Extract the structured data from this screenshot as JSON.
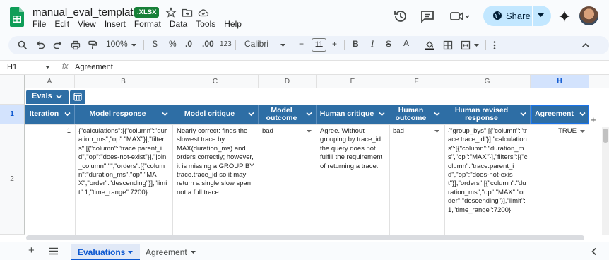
{
  "title": {
    "doc_name": "manual_eval_template",
    "badge": ".XLSX"
  },
  "menu": [
    "File",
    "Edit",
    "View",
    "Insert",
    "Format",
    "Data",
    "Tools",
    "Help"
  ],
  "share": {
    "label": "Share"
  },
  "toolbar": {
    "zoom": "100%",
    "currency": "$",
    "percent": "%",
    "dec_decrease": ".0",
    "dec_increase": ".00",
    "number_format": "123",
    "font": "Calibri",
    "font_size": "11",
    "minus": "−",
    "plus": "+"
  },
  "formula": {
    "cell_ref": "H1",
    "fx": "fx",
    "content": "Agreement"
  },
  "columns": [
    "A",
    "B",
    "C",
    "D",
    "E",
    "F",
    "G",
    "H"
  ],
  "rows": [
    "1",
    "2"
  ],
  "table": {
    "name": "Evals",
    "headers": [
      "Iteration",
      "Model response",
      "Model critique",
      "Model outcome",
      "Human critique",
      "Human outcome",
      "Human revised response",
      "Agreement"
    ]
  },
  "data_row": {
    "iteration": "1",
    "model_response": "{\"calculations\":[{\"column\":\"duration_ms\",\"op\":\"MAX\"}],\"filters\":[{\"column\":\"trace.parent_id\",\"op\":\"does-not-exist\"}],\"join_column\":\"\",\"orders\":[{\"column\":\"duration_ms\",\"op\":\"MAX\",\"order\":\"descending\"}],\"limit\":1,\"time_range\":7200}",
    "model_critique": "Nearly correct: finds the slowest trace by MAX(duration_ms) and orders correctly; however, it is missing a GROUP BY trace.trace_id so it may return a single slow span, not a full trace.",
    "model_outcome": "bad",
    "human_critique": "Agree. Without grouping by trace_id the query does not fulfill the requirement of returning a trace.",
    "human_outcome": "bad",
    "human_revised_response": "{\"group_bys\":[{\"column\":\"trace.trace_id\"}],\"calculations\":[{\"column\":\"duration_ms\",\"op\":\"MAX\"}],\"filters\":[{\"column\":\"trace.parent_id\",\"op\":\"does-not-exist\"}],\"orders\":[{\"column\":\"duration_ms\",\"op\":\"MAX\",\"order\":\"descending\"}],\"limit\":1,\"time_range\":7200}",
    "agreement": "TRUE"
  },
  "sheets": {
    "add": "+",
    "tabs": [
      "Evaluations",
      "Agreement"
    ]
  },
  "colors": {
    "table_header": "#2e6ea5",
    "accent": "#0b57d0",
    "share_bg": "#c2e7ff",
    "badge": "#188038"
  }
}
